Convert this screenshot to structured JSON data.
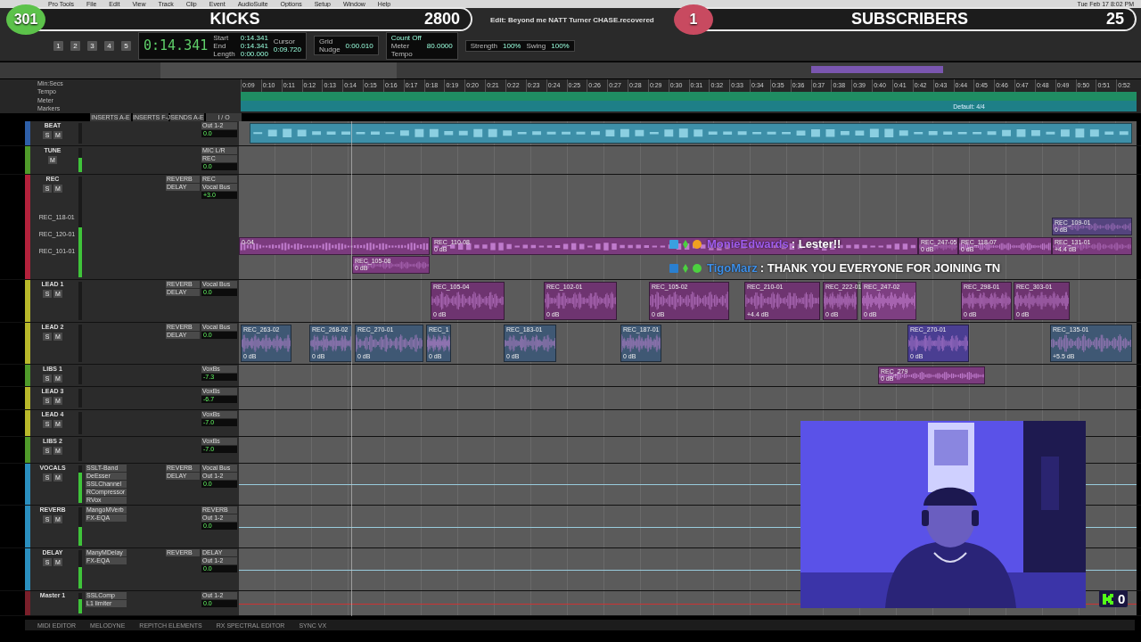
{
  "menu_bar": {
    "items": [
      "Pro Tools",
      "File",
      "Edit",
      "View",
      "Track",
      "Clip",
      "Event",
      "AudioSuite",
      "Options",
      "Setup",
      "Window",
      "Help"
    ],
    "clock": "Tue Feb 17  8:02 PM"
  },
  "window": {
    "title": "Edit: Beyond me NATT Turner CHASE.recovered"
  },
  "overlays": [
    {
      "kind": "kicks",
      "count": "301",
      "label": "KICKS",
      "total": "2800"
    },
    {
      "kind": "subs",
      "count": "1",
      "label": "SUBSCRIBERS",
      "total": "25"
    }
  ],
  "toolbar": {
    "counter": "0:14.341",
    "fields": [
      {
        "label": "Start",
        "value": "0:14.341"
      },
      {
        "label": "End",
        "value": "0:14.341"
      },
      {
        "label": "Length",
        "value": "0:00.000"
      }
    ],
    "cursor_label": "Cursor",
    "cursor_value": "0:09.720",
    "grid_label": "Grid",
    "nudge_label": "Nudge",
    "nudge_value": "0:00.010",
    "strength_label": "Strength",
    "strength_value": "100%",
    "swing_label": "Swing",
    "swing_value": "100%",
    "count_off": "Count Off",
    "meter_label": "Meter",
    "tempo_label": "Tempo",
    "tempo_value": "80.0000",
    "numbers": [
      "1",
      "2",
      "3",
      "4",
      "5"
    ]
  },
  "rulers": {
    "labels": [
      "Min:Secs",
      "Tempo",
      "Meter",
      "Markers"
    ],
    "meter_text": "Default: 4/4",
    "ticks": [
      "0:09",
      "0:10",
      "0:11",
      "0:12",
      "0:13",
      "0:14",
      "0:15",
      "0:16",
      "0:17",
      "0:18",
      "0:19",
      "0:20",
      "0:21",
      "0:22",
      "0:23",
      "0:24",
      "0:25",
      "0:26",
      "0:27",
      "0:28",
      "0:29",
      "0:30",
      "0:31",
      "0:32",
      "0:33",
      "0:34",
      "0:35",
      "0:36",
      "0:37",
      "0:38",
      "0:39",
      "0:40",
      "0:41",
      "0:42",
      "0:43",
      "0:44",
      "0:45",
      "0:46",
      "0:47",
      "0:48",
      "0:49",
      "0:50",
      "0:51",
      "0:52"
    ]
  },
  "column_headers": [
    "INSERTS A-E",
    "INSERTS F-J",
    "SENDS A-E",
    "I / O"
  ],
  "tracks": [
    {
      "name": "BEAT",
      "color": "#2e5fa8",
      "buttons": [
        "S",
        "M"
      ],
      "io": [
        "Out 1-2"
      ],
      "volume": "0.0",
      "clips": [
        {
          "color": "#3d8fa8"
        }
      ]
    },
    {
      "name": "TUNE",
      "color": "#4f9a2a",
      "buttons": [
        "M"
      ],
      "level": 0.6,
      "io": [
        "MIC L/R",
        "REC"
      ],
      "volume": "0.0"
    },
    {
      "name": "REC",
      "color": "#b3213b",
      "buttons": [
        "S",
        "M"
      ],
      "level": 0.5,
      "sends": [
        "REVERB",
        "DELAY"
      ],
      "io": [
        "REC",
        "Vocal Bus"
      ],
      "volume": "+3.0",
      "playlists": [
        "REC_118-01",
        "REC_120-01",
        "REC_101-01"
      ],
      "clips": [
        {
          "label": "0-04",
          "color": "#7b3b7e"
        },
        {
          "label": "REC_110-08",
          "gain": "0 dB",
          "color": "#7b3b7e"
        },
        {
          "label": "REC_247-05",
          "gain": "0 dB",
          "color": "#7b3b7e"
        },
        {
          "label": "REC_118-07",
          "gain": "0 dB",
          "color": "#7b3b7e"
        },
        {
          "label": "REC_131-01",
          "gain": "+4.4 dB",
          "color": "#7b3b7e"
        },
        {
          "label": "REC_105-08",
          "gain": "0 dB",
          "color": "#7b3b7e"
        },
        {
          "label": "REC_109-01",
          "gain": "0 dB",
          "color": "#54447e"
        }
      ]
    },
    {
      "name": "LEAD 1",
      "color": "#b8b82a",
      "buttons": [
        "S",
        "M"
      ],
      "sends": [
        "REVERB",
        "DELAY"
      ],
      "io": [
        "Vocal Bus"
      ],
      "volume": "0.0",
      "clips": [
        {
          "label": "REC_105-04",
          "gain": "0 dB",
          "color": "#6e3470"
        },
        {
          "label": "REC_102-01",
          "gain": "0 dB",
          "color": "#6e3470"
        },
        {
          "label": "REC_105-02",
          "gain": "0 dB",
          "color": "#6e3470"
        },
        {
          "label": "REC_210-01",
          "gain": "+4.4 dB",
          "color": "#6e3470"
        },
        {
          "label": "REC_222-01",
          "gain": "0 dB",
          "color": "#6e3470"
        },
        {
          "label": "REC_247-02",
          "gain": "0 dB",
          "color": "#7e3f82"
        },
        {
          "label": "REC_298-01",
          "gain": "0 dB",
          "color": "#6e3470"
        },
        {
          "label": "REC_303-01",
          "gain": "0 dB",
          "color": "#6e3470"
        }
      ]
    },
    {
      "name": "LEAD 2",
      "color": "#b8b82a",
      "buttons": [
        "S",
        "M"
      ],
      "sends": [
        "REVERB",
        "DELAY"
      ],
      "io": [
        "Vocal Bus"
      ],
      "volume": "0.0",
      "clips": [
        {
          "label": "REC_263-02",
          "gain": "0 dB",
          "color": "#3f5874"
        },
        {
          "label": "REC_268-02",
          "gain": "0 dB",
          "color": "#3f5874"
        },
        {
          "label": "REC_270-01",
          "gain": "0 dB",
          "color": "#3f5874"
        },
        {
          "label": "REC_1",
          "gain": "0 dB",
          "color": "#3f5874"
        },
        {
          "label": "REC_183-01",
          "gain": "0 dB",
          "color": "#3f5874"
        },
        {
          "label": "REC_187-01",
          "gain": "0 dB",
          "color": "#3f5874"
        },
        {
          "label": "REC_270-01",
          "gain": "0 dB",
          "color": "#4a3e92"
        },
        {
          "label": "REC_135-01",
          "gain": "+5.5 dB",
          "color": "#3f5874"
        }
      ]
    },
    {
      "name": "LIBS 1",
      "color": "#4f9a2a",
      "buttons": [
        "S",
        "M"
      ],
      "io": [
        "VoxBs"
      ],
      "volume": "-7.3",
      "clips": [
        {
          "label": "REC_279",
          "gain": "0 dB",
          "color": "#7b3b7e"
        }
      ]
    },
    {
      "name": "LEAD 3",
      "color": "#b8b82a",
      "buttons": [
        "S",
        "M"
      ],
      "io": [
        "VoxBs"
      ],
      "volume": "-6.7"
    },
    {
      "name": "LEAD 4",
      "color": "#b8b82a",
      "buttons": [
        "S",
        "M"
      ],
      "io": [
        "VoxBs"
      ],
      "volume": "-7.0"
    },
    {
      "name": "LIBS 2",
      "color": "#4f9a2a",
      "buttons": [
        "S",
        "M"
      ],
      "io": [
        "VoxBs"
      ],
      "volume": "-7.0"
    },
    {
      "name": "VOCALS",
      "color": "#2a8fbf",
      "buttons": [
        "S",
        "M"
      ],
      "level": 0.8,
      "inserts": [
        "SSLT-Band",
        "DeEsser",
        "SSLChannel",
        "RCompressor",
        "RVox"
      ],
      "sends": [
        "REVERB",
        "DELAY"
      ],
      "io": [
        "Vocal Bus",
        "Out 1-2"
      ],
      "volume": "0.0"
    },
    {
      "name": "REVERB",
      "color": "#2a8fbf",
      "buttons": [
        "S",
        "M"
      ],
      "level": 0.5,
      "inserts": [
        "MangoMVerb",
        "FX-EQA"
      ],
      "io": [
        "REVERB",
        "Out 1-2"
      ],
      "volume": "0.0"
    },
    {
      "name": "DELAY",
      "color": "#2a8fbf",
      "buttons": [
        "S",
        "M"
      ],
      "level": 0.55,
      "inserts": [
        "ManyMDelay",
        "FX-EQA"
      ],
      "sends": [
        "REVERB"
      ],
      "io": [
        "DELAY",
        "Out 1-2"
      ],
      "volume": "0.0"
    },
    {
      "name": "Master 1",
      "color": "#7a1f2a",
      "level": 0.7,
      "inserts": [
        "SSLComp",
        "L1 limiter"
      ],
      "io": [
        "Out 1-2"
      ],
      "volume": "0.0"
    }
  ],
  "chat": [
    {
      "user": "MonieEdwards",
      "color": "#a25cf0",
      "message": ": Lester!!"
    },
    {
      "user": "TigoMarz",
      "color": "#3d8fe8",
      "message": ": THANK YOU EVERYONE FOR JOINING TN"
    }
  ],
  "webcam": {
    "kind": "picture"
  },
  "kick_badge": {
    "count": "0"
  },
  "bottom_tabs": [
    "MIDI EDITOR",
    "MELODYNE",
    "REPITCH ELEMENTS",
    "RX SPECTRAL EDITOR",
    "SYNC VX"
  ]
}
